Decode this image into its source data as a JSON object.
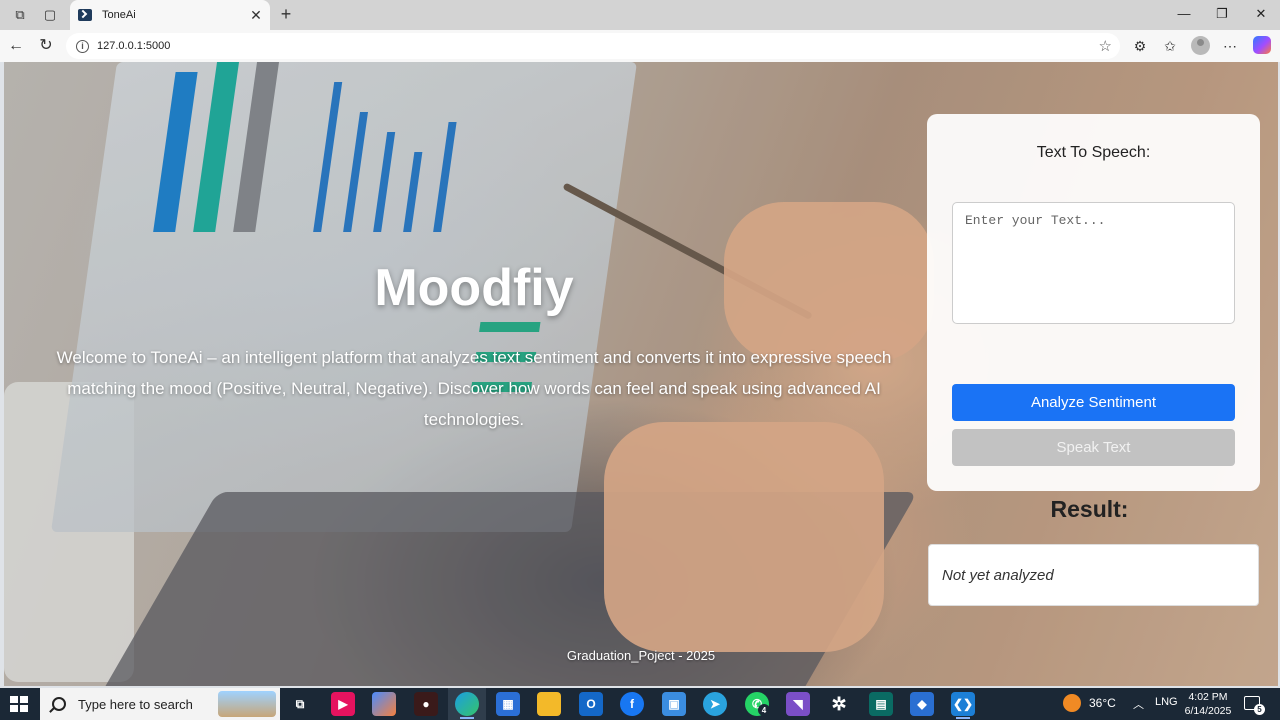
{
  "browser": {
    "tab_title": "ToneAi",
    "url": "127.0.0.1:5000"
  },
  "hero": {
    "title": "Moodfiy",
    "description": "Welcome to ToneAi – an intelligent platform that analyzes text sentiment and converts it into expressive speech matching the mood (Positive, Neutral, Negative). Discover how words can feel and speak using advanced AI technologies."
  },
  "tts_card": {
    "title": "Text To Speech:",
    "input_placeholder": "Enter your Text...",
    "analyze_label": "Analyze Sentiment",
    "speak_label": "Speak Text"
  },
  "result": {
    "title": "Result:",
    "value": "Not yet analyzed"
  },
  "footer": {
    "text": "Graduation_Poject - 2025"
  },
  "taskbar": {
    "search_placeholder": "Type here to search",
    "weather": "36°C",
    "language": "LNG",
    "time": "4:02 PM",
    "date": "6/14/2025",
    "whatsapp_badge": "4",
    "notification_count": "5"
  },
  "colors": {
    "primary_button": "#1a73f5",
    "disabled_button": "#c2c2c2",
    "taskbar": "#1b2836"
  }
}
